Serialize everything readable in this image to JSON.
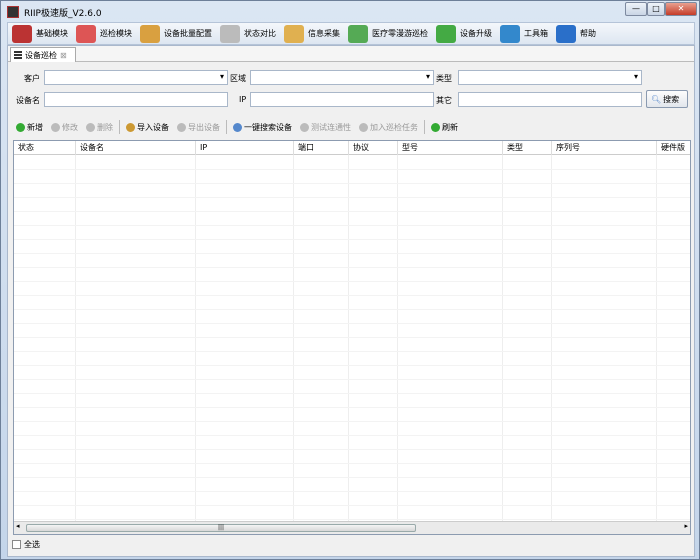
{
  "window": {
    "title": "RIIP极速版_V2.6.0",
    "minimize": "—",
    "maximize": "□",
    "close": "✕"
  },
  "menu": [
    {
      "label": "基础模块",
      "icon": "books-icon",
      "color": "#b33"
    },
    {
      "label": "巡检模块",
      "icon": "calendar-clock-icon",
      "color": "#d55"
    },
    {
      "label": "设备批量配置",
      "icon": "box-icon",
      "color": "#d9a040"
    },
    {
      "label": "状态对比",
      "icon": "table-icon",
      "color": "#bbb"
    },
    {
      "label": "信息采集",
      "icon": "clipboard-icon",
      "color": "#e0b050"
    },
    {
      "label": "医疗零漫游巡检",
      "icon": "medical-cross-icon",
      "color": "#5a5"
    },
    {
      "label": "设备升级",
      "icon": "tree-upgrade-icon",
      "color": "#4a4"
    },
    {
      "label": "工具箱",
      "icon": "toolbox-icon",
      "color": "#38c"
    },
    {
      "label": "帮助",
      "icon": "help-icon",
      "color": "#2a6fc9"
    }
  ],
  "tab": {
    "label": "设备巡检",
    "close": "⊠"
  },
  "filters": {
    "customer": "客户",
    "area": "区域",
    "type": "类型",
    "device_name": "设备名",
    "ip": "IP",
    "other": "其它",
    "search": "搜索"
  },
  "actions": [
    {
      "label": "新增",
      "icon": "add-icon",
      "color": "#3a3",
      "enabled": true
    },
    {
      "label": "修改",
      "icon": "edit-icon",
      "color": "#bbb",
      "enabled": false
    },
    {
      "label": "删除",
      "icon": "delete-icon",
      "color": "#bbb",
      "enabled": false
    },
    {
      "label": "导入设备",
      "icon": "import-icon",
      "color": "#c93",
      "enabled": true
    },
    {
      "label": "导出设备",
      "icon": "export-icon",
      "color": "#bbb",
      "enabled": false
    },
    {
      "label": "一键搜索设备",
      "icon": "search-icon",
      "color": "#58c",
      "enabled": true
    },
    {
      "label": "测试连通性",
      "icon": "test-icon",
      "color": "#bbb",
      "enabled": false
    },
    {
      "label": "加入巡检任务",
      "icon": "task-icon",
      "color": "#bbb",
      "enabled": false
    },
    {
      "label": "刷新",
      "icon": "refresh-icon",
      "color": "#3a3",
      "enabled": true
    }
  ],
  "table": {
    "columns": [
      "状态",
      "设备名",
      "IP",
      "端口",
      "协议",
      "型号",
      "类型",
      "序列号",
      "硬件版"
    ]
  },
  "scroll_grip": "|||",
  "footer": {
    "select_all": "全选"
  }
}
